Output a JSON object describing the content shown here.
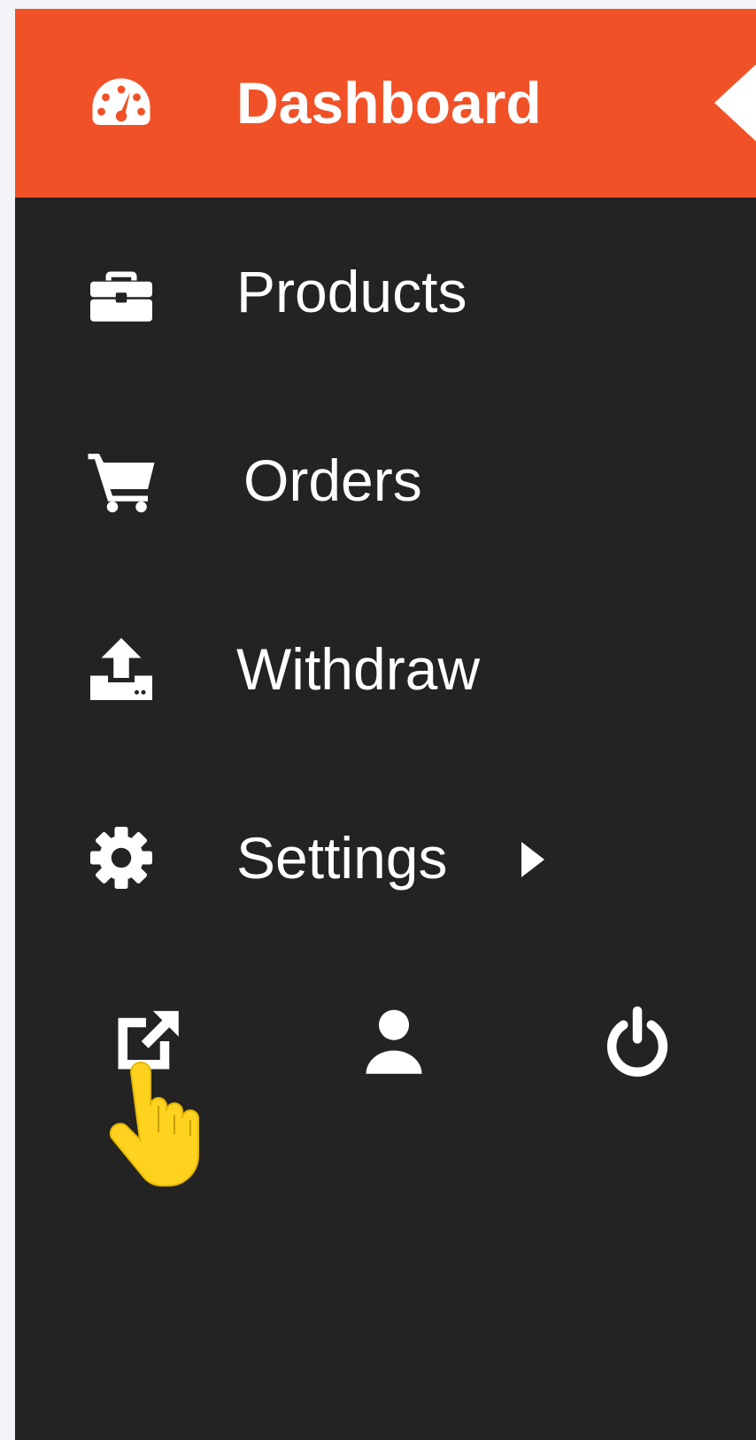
{
  "sidebar": {
    "items": [
      {
        "label": "Dashboard",
        "icon": "dashboard-gauge-icon",
        "active": true
      },
      {
        "label": "Products",
        "icon": "briefcase-icon"
      },
      {
        "label": "Orders",
        "icon": "shopping-cart-icon"
      },
      {
        "label": "Withdraw",
        "icon": "upload-tray-icon"
      },
      {
        "label": "Settings",
        "icon": "gear-icon",
        "has_submenu": true
      }
    ],
    "footer_icons": [
      "external-link-icon",
      "user-icon",
      "power-icon"
    ]
  },
  "colors": {
    "sidebar_bg": "#232323",
    "active_bg": "#f05127",
    "text": "#ffffff",
    "page_bg": "#f3f4f8",
    "cursor": "#ffd21f"
  }
}
